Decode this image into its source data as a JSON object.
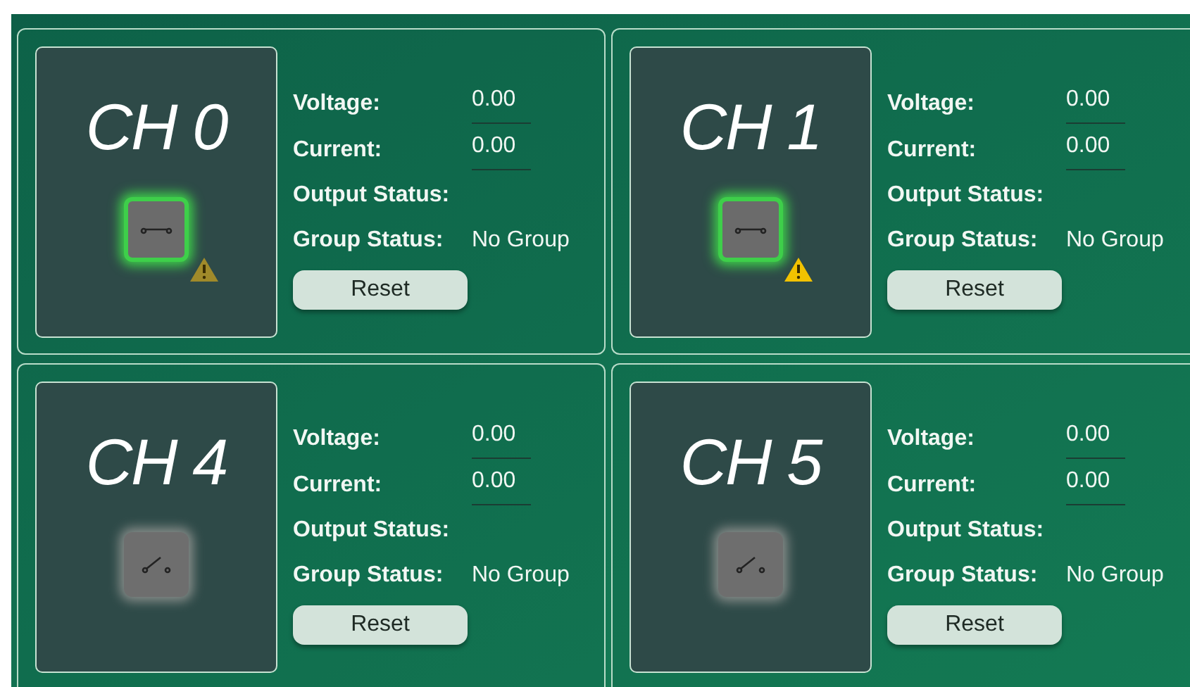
{
  "channels": [
    {
      "title": "CH 0",
      "on": true,
      "warning": {
        "color": "#a08a2a"
      },
      "voltage_label": "Voltage:",
      "voltage": "0.00",
      "current_label": "Current:",
      "current": "0.00",
      "output_label": "Output Status:",
      "group_label": "Group Status:",
      "group": "No Group",
      "button": "Reset"
    },
    {
      "title": "CH 1",
      "on": true,
      "warning": {
        "color": "#f2c200"
      },
      "voltage_label": "Voltage:",
      "voltage": "0.00",
      "current_label": "Current:",
      "current": "0.00",
      "output_label": "Output Status:",
      "group_label": "Group Status:",
      "group": "No Group",
      "button": "Reset"
    },
    {
      "title": "CH 4",
      "on": false,
      "voltage_label": "Voltage:",
      "voltage": "0.00",
      "current_label": "Current:",
      "current": "0.00",
      "output_label": "Output Status:",
      "group_label": "Group Status:",
      "group": "No Group",
      "button": "Reset"
    },
    {
      "title": "CH 5",
      "on": false,
      "voltage_label": "Voltage:",
      "voltage": "0.00",
      "current_label": "Current:",
      "current": "0.00",
      "output_label": "Output Status:",
      "group_label": "Group Status:",
      "group": "No Group",
      "button": "Reset"
    }
  ]
}
